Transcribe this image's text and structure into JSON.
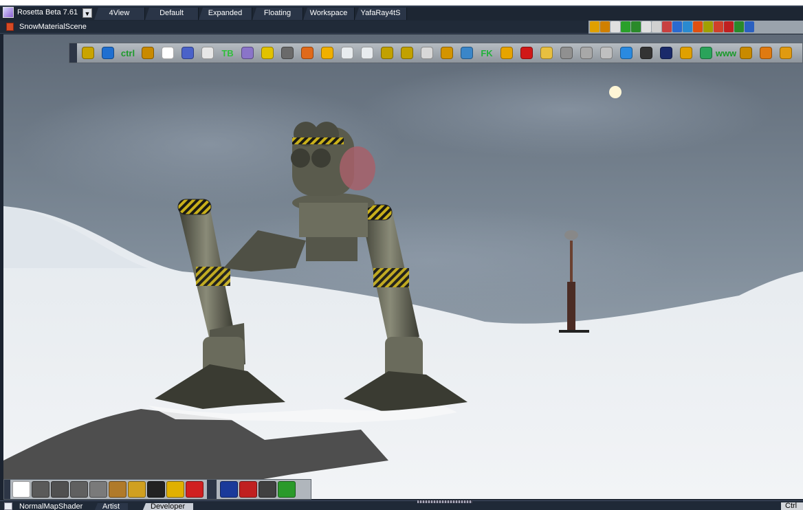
{
  "app": {
    "title": "Rosetta Beta 7.61",
    "logo_icon": "app-logo-icon",
    "dropdown_icon": "chevron-down-icon"
  },
  "tabs": [
    {
      "label": "4View"
    },
    {
      "label": "Default"
    },
    {
      "label": "Expanded"
    },
    {
      "label": "Floating"
    },
    {
      "label": "Workspace"
    },
    {
      "label": "YafaRay4tS"
    }
  ],
  "scene": {
    "name": "SnowMaterialScene",
    "icon": "scene-icon"
  },
  "main_toolbar": {
    "items": [
      {
        "icon": "link-icon",
        "text": "",
        "color": "#c9a400"
      },
      {
        "icon": "book-icon",
        "text": "",
        "color": "#1f6fd0"
      },
      {
        "icon": "ctrl-icon",
        "text": "ctrl",
        "color": "#1c9a2a"
      },
      {
        "icon": "brush-icon",
        "text": "",
        "color": "#c98a00"
      },
      {
        "icon": "sparkle-icon",
        "text": "",
        "color": "#ffffff"
      },
      {
        "icon": "particles-icon",
        "text": "",
        "color": "#4a62c9"
      },
      {
        "icon": "shader-icon",
        "text": "",
        "color": "#e7e7e7"
      },
      {
        "icon": "tb-icon",
        "text": "TB",
        "color": "#2fbf3a"
      },
      {
        "icon": "layers-icon",
        "text": "",
        "color": "#8a74c9"
      },
      {
        "icon": "banana-icon",
        "text": "",
        "color": "#e2c200"
      },
      {
        "icon": "light-icon",
        "text": "",
        "color": "#6a6a6a"
      },
      {
        "icon": "grid-orange-icon",
        "text": "",
        "color": "#e06a1a"
      },
      {
        "icon": "grid-yellow-icon",
        "text": "",
        "color": "#f0b000"
      },
      {
        "icon": "rect-icon",
        "text": "",
        "color": "#e8ecef"
      },
      {
        "icon": "split-rect-icon",
        "text": "",
        "color": "#e8ecef"
      },
      {
        "icon": "frame-icon",
        "text": "",
        "color": "#c2a100"
      },
      {
        "icon": "lasso-icon",
        "text": "",
        "color": "#c2a100"
      },
      {
        "icon": "cursor-icon",
        "text": "",
        "color": "#d8d8d8"
      },
      {
        "icon": "ring-icon",
        "text": "",
        "color": "#d39400"
      },
      {
        "icon": "dolphin-icon",
        "text": "",
        "color": "#3a86c9"
      },
      {
        "icon": "fk-icon",
        "text": "FK",
        "color": "#21b13a"
      },
      {
        "icon": "bone-icon",
        "text": "",
        "color": "#e7a400"
      },
      {
        "icon": "axis-icon",
        "text": "",
        "color": "#d01818"
      },
      {
        "icon": "save-icon",
        "text": "",
        "color": "#e8c040"
      },
      {
        "icon": "joint-icon",
        "text": "",
        "color": "#909090"
      },
      {
        "icon": "torus-icon",
        "text": "",
        "color": "#a8a8a8"
      },
      {
        "icon": "scissors-icon",
        "text": "",
        "color": "#c0c0c0"
      },
      {
        "icon": "bar-chart-icon",
        "text": "",
        "color": "#2a8ae0"
      },
      {
        "icon": "cube-dark-icon",
        "text": "",
        "color": "#333333"
      },
      {
        "icon": "unreal-icon",
        "text": "",
        "color": "#1a2a6a"
      },
      {
        "icon": "lock-icon",
        "text": "",
        "color": "#e0a000"
      },
      {
        "icon": "globe-icon",
        "text": "",
        "color": "#2aa35a"
      },
      {
        "icon": "www-icon",
        "text": "www",
        "color": "#1a9a2a"
      },
      {
        "icon": "d3d-icon",
        "text": "",
        "color": "#c98a00"
      },
      {
        "icon": "bricks-icon",
        "text": "",
        "color": "#e07a10"
      },
      {
        "icon": "donut-icon",
        "text": "",
        "color": "#e09a10"
      }
    ]
  },
  "top_right_tools": [
    {
      "icon": "pencil-icon",
      "color": "#e0a000"
    },
    {
      "icon": "rotate-icon",
      "color": "#d08000"
    },
    {
      "icon": "close-x-icon",
      "color": "#e0e0e0"
    },
    {
      "icon": "check-icon",
      "color": "#2aa02a"
    },
    {
      "icon": "refresh-icon",
      "color": "#2a8a2a"
    },
    {
      "icon": "close-x-icon",
      "color": "#e0e0e0"
    },
    {
      "icon": "cross-icon",
      "color": "#d0d0d0"
    },
    {
      "icon": "checker-icon",
      "color": "#c84040"
    },
    {
      "icon": "cube-icon",
      "color": "#2a6ad0"
    },
    {
      "icon": "wrench-icon",
      "color": "#2a8ad0"
    },
    {
      "icon": "fire-icon",
      "color": "#e05010"
    },
    {
      "icon": "brush-icon",
      "color": "#a0a000"
    },
    {
      "icon": "paint-icon",
      "color": "#d0402a"
    },
    {
      "icon": "axis-icon",
      "color": "#c02020"
    },
    {
      "icon": "arrow-icon",
      "color": "#2a8a2a"
    },
    {
      "icon": "arrow-up-icon",
      "color": "#2a60c0"
    }
  ],
  "bottom_toolbar": {
    "group1": [
      {
        "icon": "select-arrow-icon",
        "color": "#ffffff"
      },
      {
        "icon": "sphere-icon",
        "color": "#5a5a5a"
      },
      {
        "icon": "box-icon",
        "color": "#505050"
      },
      {
        "icon": "plane-icon",
        "color": "#606060"
      },
      {
        "icon": "cylinder-icon",
        "color": "#7a7a7a"
      },
      {
        "icon": "hair-icon",
        "color": "#b07a2a"
      },
      {
        "icon": "palette-icon",
        "color": "#d0a020"
      },
      {
        "icon": "ring-black-icon",
        "color": "#222222"
      },
      {
        "icon": "add-node-icon",
        "color": "#e0b000"
      },
      {
        "icon": "toolbox-icon",
        "color": "#d02020"
      }
    ],
    "group2": [
      {
        "icon": "scissors-icon",
        "color": "#1a3a9a"
      },
      {
        "icon": "toolbox-icon",
        "color": "#c02020"
      },
      {
        "icon": "tripod-icon",
        "color": "#404040"
      },
      {
        "icon": "rubik-cube-icon",
        "color": "#2a9a2a"
      }
    ]
  },
  "status": {
    "shader_name": "NormalMapShader",
    "tabs": [
      {
        "label": "Artist"
      },
      {
        "label": "Developer"
      }
    ],
    "ctrl_label": "Ctrl"
  }
}
